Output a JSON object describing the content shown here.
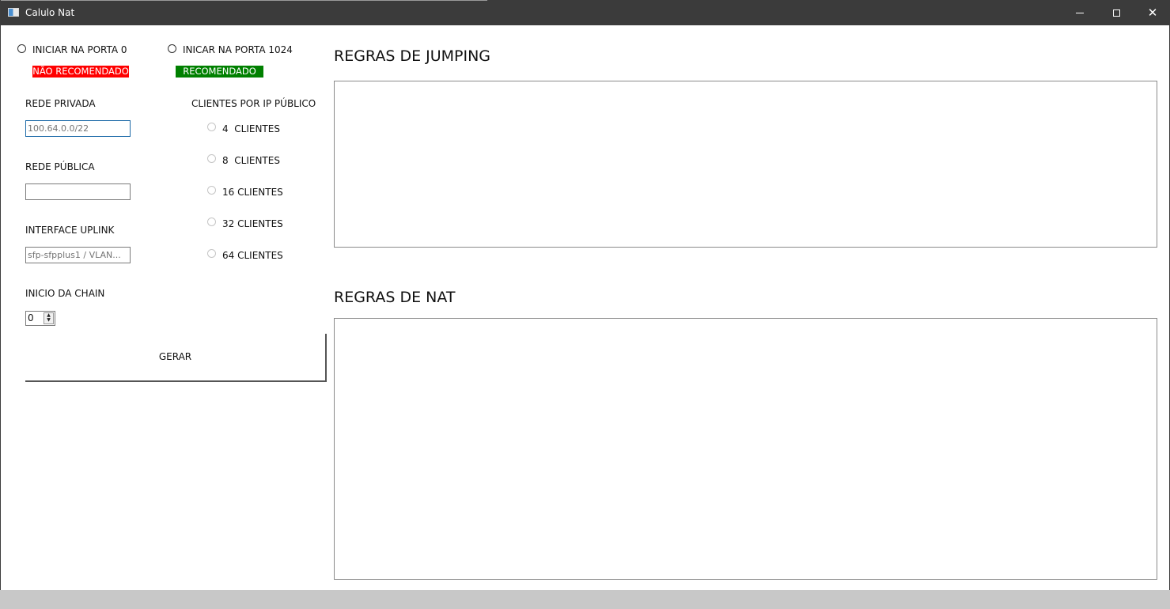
{
  "window": {
    "title": "Calulo Nat",
    "minimize_icon": "minimize-icon",
    "maximize_icon": "maximize-icon",
    "close_icon": "close-icon",
    "close_glyph": "✕"
  },
  "port_options": {
    "port0_label": "INICIAR NA PORTA 0",
    "port0_badge": "NÃO RECOMENDADO",
    "port0_badge_color": "#ff0000",
    "port1024_label": "INICAR NA PORTA 1024",
    "port1024_badge": "RECOMENDADO",
    "port1024_badge_color": "#008000"
  },
  "form": {
    "private_network_label": "REDE PRIVADA",
    "private_network_placeholder": "100.64.0.0/22",
    "public_network_label": "REDE PÚBLICA",
    "public_network_value": "",
    "uplink_label": "INTERFACE UPLINK",
    "uplink_placeholder": "sfp-sfpplus1 / VLAN...",
    "chain_start_label": "INICIO DA CHAIN",
    "chain_start_value": "0",
    "spin_up_glyph": "▲",
    "spin_down_glyph": "▼",
    "generate_button": "GERAR"
  },
  "clients": {
    "header": "CLIENTES POR IP PÚBLICO",
    "options": [
      "4  CLIENTES",
      "8  CLIENTES",
      "16 CLIENTES",
      "32 CLIENTES",
      "64 CLIENTES"
    ]
  },
  "output": {
    "jumping_title": "REGRAS DE JUMPING",
    "nat_title": "REGRAS DE NAT"
  }
}
